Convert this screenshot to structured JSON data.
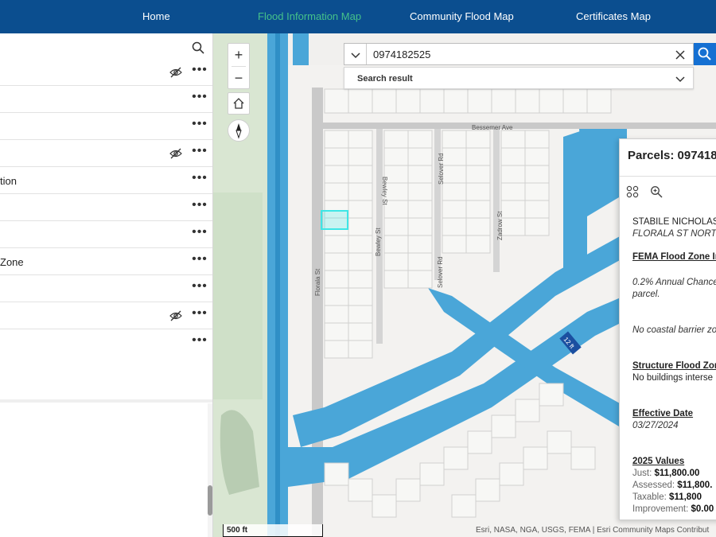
{
  "nav": {
    "items": [
      {
        "label": "Home",
        "active": false
      },
      {
        "label": "Flood Information Map",
        "active": true
      },
      {
        "label": "Community Flood Map",
        "active": false
      },
      {
        "label": "Certificates Map",
        "active": false
      }
    ],
    "bg_color": "#0b4e8f",
    "active_color": "#45c18a"
  },
  "layers": {
    "rows": [
      {
        "label": "",
        "hidden": true
      },
      {
        "label": "",
        "hidden": false
      },
      {
        "label": "",
        "hidden": false
      },
      {
        "label": "",
        "hidden": true
      },
      {
        "label": "tion",
        "hidden": false
      },
      {
        "label": "",
        "hidden": false
      },
      {
        "label": "",
        "hidden": false
      },
      {
        "label": "Zone",
        "hidden": false
      },
      {
        "label": "",
        "hidden": false
      },
      {
        "label": "",
        "hidden": true
      },
      {
        "label": "",
        "hidden": false
      }
    ],
    "more_label": "•••"
  },
  "map": {
    "zoom_in": "+",
    "zoom_out": "−",
    "search": {
      "value": "0974182525",
      "result_label": "Search result"
    },
    "streets": [
      "Bessemer Ave",
      "Selover Rd",
      "Zadrow St",
      "Florala St",
      "Bewley St",
      "Bewley St",
      "Selover Rd"
    ],
    "depth_label": "12 ft",
    "scale_label": "500 ft",
    "attribution": "Esri, NASA, NGA, USGS, FEMA | Esri Community Maps Contribut",
    "flood_color": "#4aa6d8",
    "highlight_color": "#3ee6e6"
  },
  "popup": {
    "title": "Parcels: 097418",
    "owner": "STABILE NICHOLAS",
    "address": "FLORALA ST NORTH",
    "fema_heading": "FEMA Flood Zone In",
    "fema_line1": "0.2% Annual Chance",
    "fema_line2": "parcel.",
    "coastal": "No coastal barrier zo",
    "structure_heading": "Structure Flood Zone",
    "structure_value": "No buildings interse",
    "effective_heading": "Effective Date",
    "effective_value": "03/27/2024",
    "values_heading": "2025 Values",
    "just_label": "Just:",
    "just_value": "$11,800.00",
    "assessed_label": "Assessed:",
    "assessed_value": "$11,800.",
    "taxable_label": "Taxable:",
    "taxable_value": "$11,800",
    "improvement_label": "Improvement:",
    "improvement_value": "$0.00"
  }
}
